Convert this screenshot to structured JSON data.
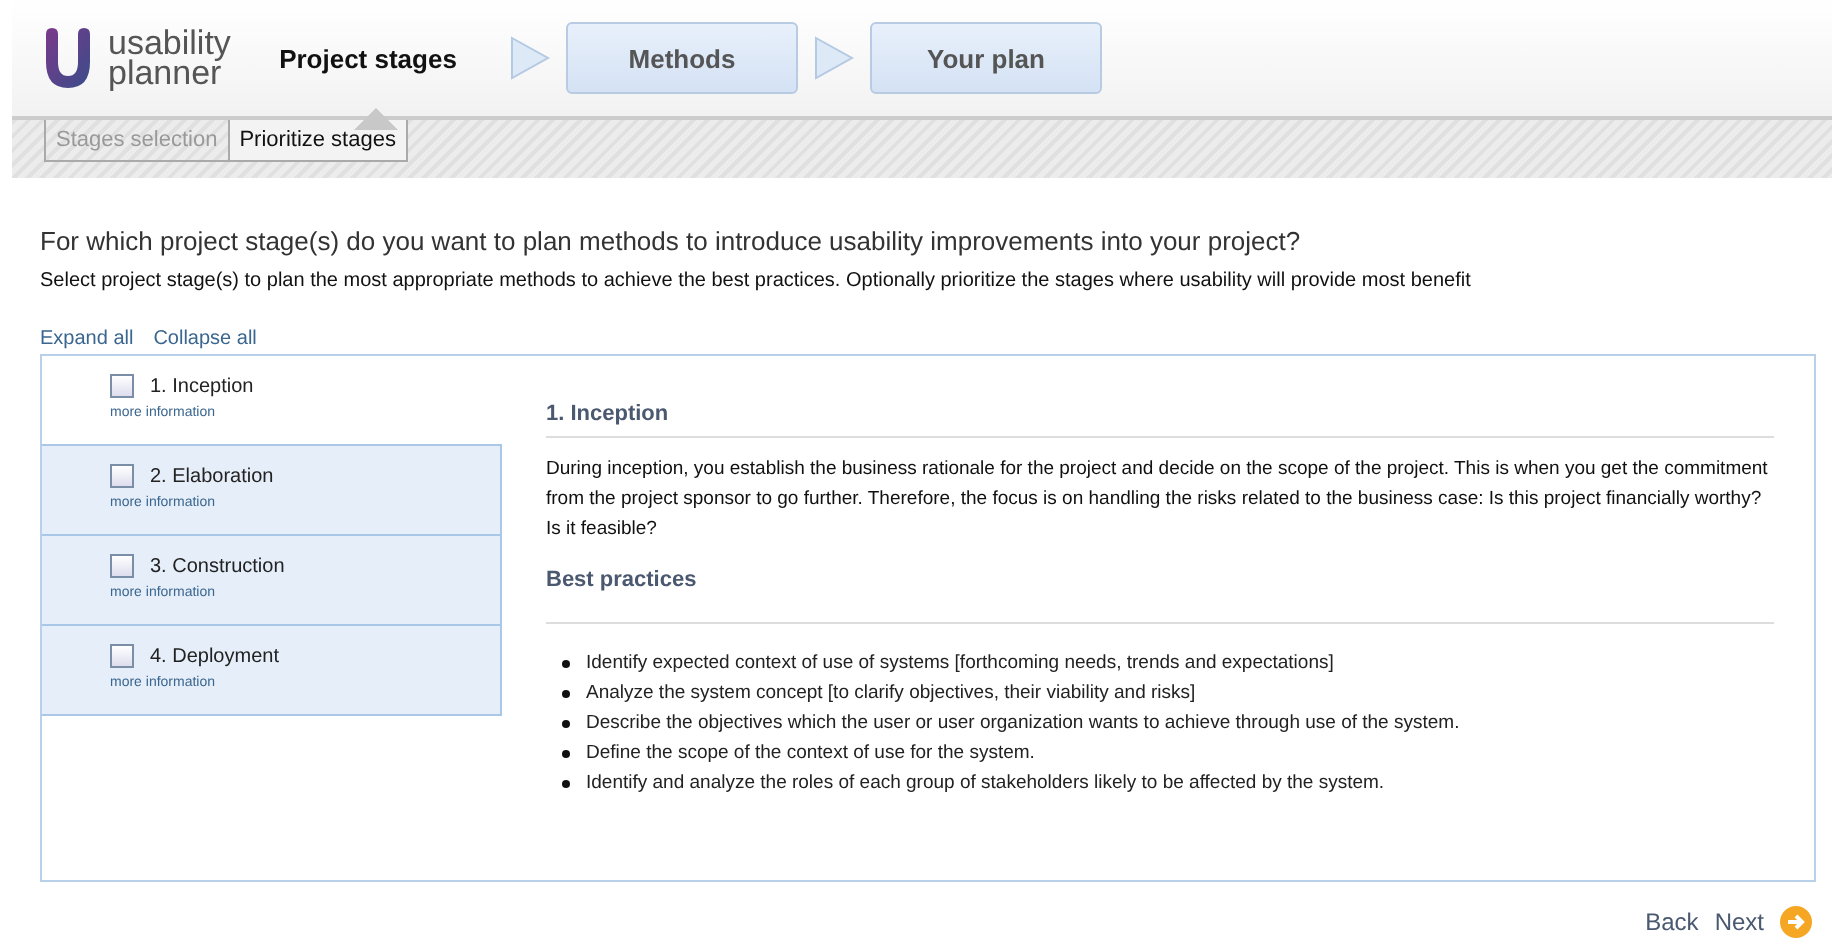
{
  "logo": {
    "line1": "usability",
    "line2": "planner"
  },
  "steps": [
    {
      "label": "Project stages",
      "selected": true
    },
    {
      "label": "Methods",
      "selected": false
    },
    {
      "label": "Your plan",
      "selected": false
    }
  ],
  "subtabs": [
    {
      "label": "Stages selection",
      "disabled": true
    },
    {
      "label": "Prioritize stages",
      "disabled": false
    }
  ],
  "question": "For which project stage(s) do you want to plan methods to introduce usability improvements into your project?",
  "intro": "Select project stage(s) to plan the most appropriate methods to achieve the best practices. Optionally prioritize the stages where usability will provide most benefit",
  "expand_all": "Expand all",
  "collapse_all": "Collapse all",
  "stages": [
    {
      "label": "1. Inception",
      "more": "more information",
      "checked": false,
      "selected": true
    },
    {
      "label": "2. Elaboration",
      "more": "more information",
      "checked": false,
      "selected": false
    },
    {
      "label": "3. Construction",
      "more": "more information",
      "checked": false,
      "selected": false
    },
    {
      "label": "4. Deployment",
      "more": "more information",
      "checked": false,
      "selected": false
    }
  ],
  "detail": {
    "title": "1. Inception",
    "text": "During inception, you establish the business rationale for the project and decide on the scope of the project. This is when you get the commitment from the project sponsor to go further. Therefore, the focus is on handling the risks related to the business case: Is this project financially worthy? Is it feasible?",
    "practices_title": "Best practices",
    "practices": [
      "Identify expected context of use of systems [forthcoming needs, trends and expectations]",
      "Analyze the system concept [to clarify objectives, their viability and risks]",
      "Describe the objectives which the user or user organization wants to achieve through use of the system.",
      "Define the scope of the context of use for the system.",
      "Identify and analyze the roles of each group of stakeholders likely to be affected by the system."
    ]
  },
  "back": "Back",
  "next": "Next"
}
